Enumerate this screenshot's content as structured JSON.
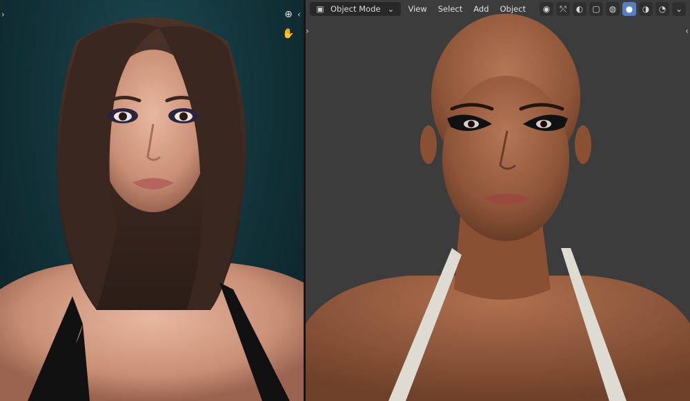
{
  "toolbar": {
    "mode_label": "Object Mode",
    "menus": [
      "View",
      "Select",
      "Add",
      "Object"
    ]
  },
  "icons": {
    "zoom": "zoom-icon",
    "hand": "hand-pan-icon",
    "mode": "object-mode-icon",
    "dropdown": "chevron-down-icon",
    "view_gizmo": "viewport-gizmo-icon",
    "navigation": "navigation-icon",
    "overlays": "overlay-icon",
    "xray": "xray-icon",
    "wireframe": "wireframe-shading-icon",
    "solid": "solid-shading-icon",
    "material": "material-shading-icon",
    "rendered": "rendered-shading-icon"
  },
  "colors": {
    "left_bg": "#13353c",
    "right_bg": "#3c3c3c",
    "active_shading": "#5680c2",
    "skin_left": "#d9a58c",
    "skin_right": "#a86a4b",
    "hair": "#3d2a22",
    "top_left": "#111111",
    "strap_right": "#dedbd3"
  }
}
